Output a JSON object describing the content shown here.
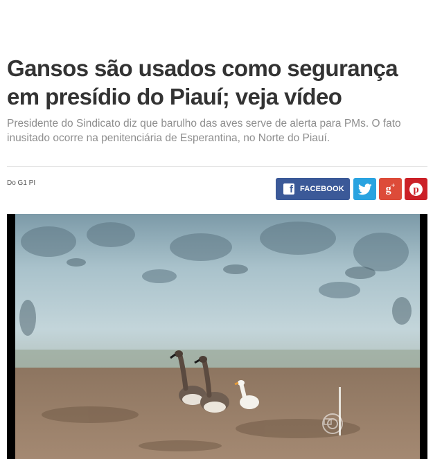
{
  "article": {
    "headline": "Gansos são usados como segurança em presídio do Piauí; veja vídeo",
    "subtitle": "Presidente do Sindicato diz que barulho das aves serve de alerta para PMs. O fato inusitado ocorre na penitenciária de Esperantina, no Norte do Piauí.",
    "byline": "Do G1 PI"
  },
  "share": {
    "facebook_label": "FACEBOOK",
    "facebook_icon": "facebook-icon",
    "twitter_icon": "twitter-icon",
    "google_plus_icon": "google-plus-icon",
    "pinterest_icon": "pinterest-icon",
    "colors": {
      "facebook": "#3b5998",
      "twitter": "#2aa3e0",
      "google_plus": "#dd4b39",
      "pinterest": "#cb2027"
    }
  },
  "video": {
    "scene": "Three geese walking in a prison yard in front of a weathered blue wall",
    "watermark_icon": "globo-logo-icon"
  }
}
